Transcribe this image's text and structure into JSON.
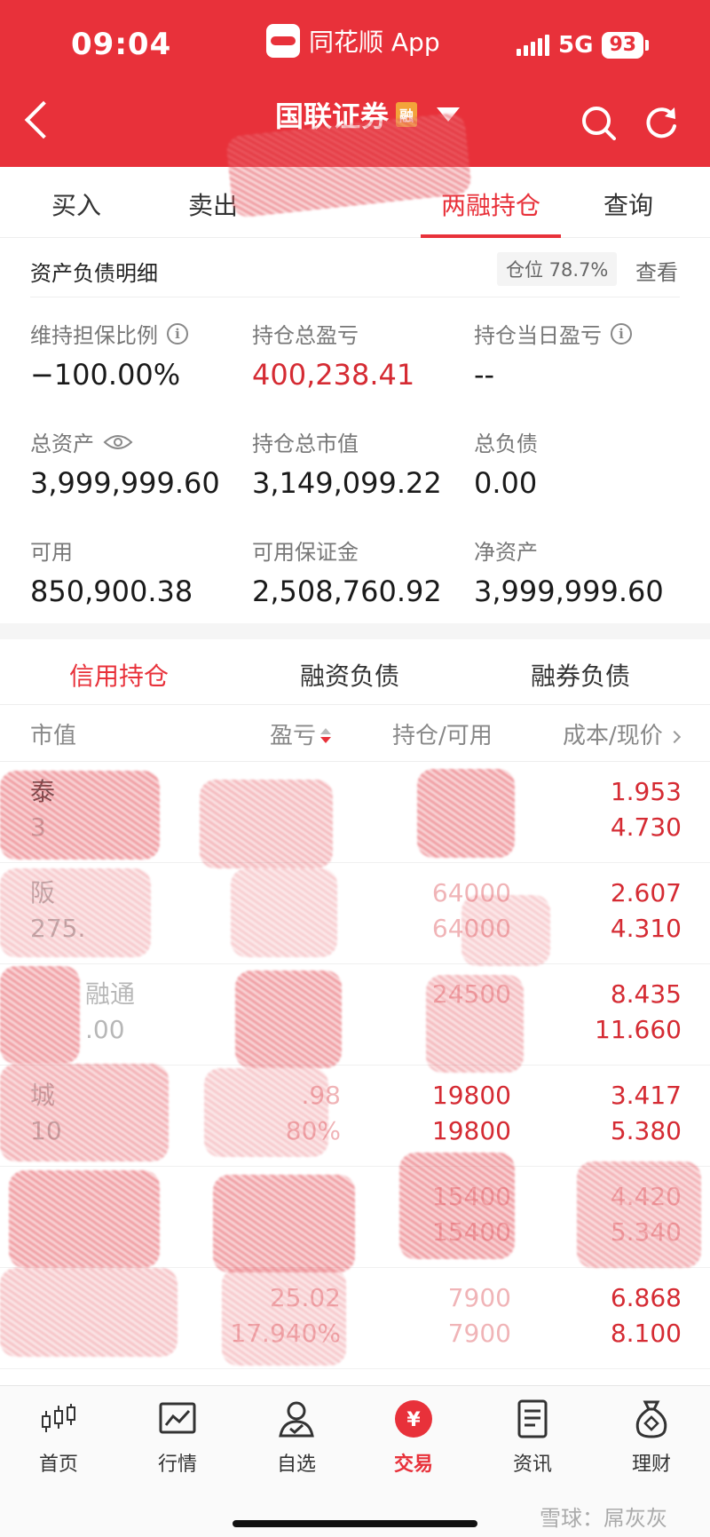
{
  "status_bar": {
    "time": "09:04",
    "app_name": "同花顺 App",
    "network": "5G",
    "battery": "93"
  },
  "nav": {
    "title": "国联证券",
    "badge": "融"
  },
  "trade_tabs": [
    "买入",
    "卖出",
    "两融持仓",
    "查询"
  ],
  "active_trade_tab": "两融持仓",
  "summary": {
    "title": "资产负债明细",
    "position_ratio": "仓位 78.7%",
    "view_label": "查看",
    "metrics": [
      {
        "label": "维持担保比例",
        "value": "−100.00%"
      },
      {
        "label": "持仓总盈亏",
        "value": "400,238.41"
      },
      {
        "label": "持仓当日盈亏",
        "value": "--"
      },
      {
        "label": "总资产",
        "value": "3,999,999.60"
      },
      {
        "label": "持仓总市值",
        "value": "3,149,099.22"
      },
      {
        "label": "总负债",
        "value": "0.00"
      },
      {
        "label": "可用",
        "value": "850,900.38"
      },
      {
        "label": "可用保证金",
        "value": "2,508,760.92"
      },
      {
        "label": "净资产",
        "value": "3,999,999.60"
      }
    ]
  },
  "credit_tabs": [
    "信用持仓",
    "融资负债",
    "融券负债"
  ],
  "active_credit_tab": "信用持仓",
  "table": {
    "columns": [
      "市值",
      "盈亏",
      "持仓/可用",
      "成本/现价"
    ],
    "rows": [
      {
        "name": "泰",
        "mv": "3",
        "pl": "",
        "pl_pct": "",
        "hold": "",
        "avail": "",
        "cost": "1.953",
        "price": "4.730"
      },
      {
        "name": "阪",
        "mv": "275.",
        "pl": "",
        "pl_pct": "",
        "hold": "64000",
        "avail": "64000",
        "cost": "2.607",
        "price": "4.310"
      },
      {
        "name": "融通",
        "mv": ".00",
        "pl": "",
        "pl_pct": "",
        "hold": "24500",
        "avail": "",
        "cost": "8.435",
        "price": "11.660"
      },
      {
        "name": "城",
        "mv": "10",
        "pl": ".98",
        "pl_pct": "80%",
        "hold": "19800",
        "avail": "19800",
        "cost": "3.417",
        "price": "5.380"
      },
      {
        "name": "",
        "mv": "",
        "pl": "",
        "pl_pct": "",
        "hold": "15400",
        "avail": "15400",
        "cost": "4.420",
        "price": "5.340"
      },
      {
        "name": "",
        "mv": "",
        "pl": "25.02",
        "pl_pct": "17.940%",
        "hold": "7900",
        "avail": "7900",
        "cost": "6.868",
        "price": "8.100"
      }
    ]
  },
  "bottom_nav": [
    {
      "label": "首页",
      "icon": "candlestick-icon"
    },
    {
      "label": "行情",
      "icon": "chart-icon"
    },
    {
      "label": "自选",
      "icon": "user-check-icon"
    },
    {
      "label": "交易",
      "icon": "yuan-icon"
    },
    {
      "label": "资讯",
      "icon": "document-icon"
    },
    {
      "label": "理财",
      "icon": "money-bag-icon"
    }
  ],
  "active_nav": "交易",
  "watermark": "雪球：屌灰灰",
  "colors": {
    "brand_red": "#e8313a",
    "value_red": "#d52b33",
    "badge_orange": "#f3a33a"
  }
}
